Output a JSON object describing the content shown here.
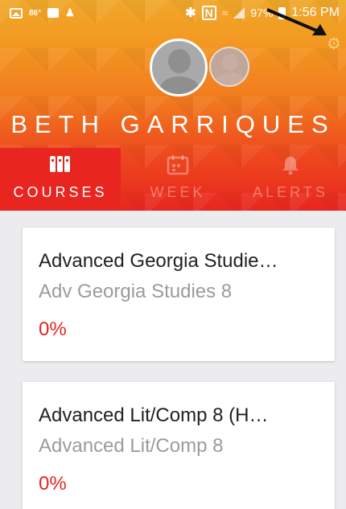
{
  "status_bar": {
    "temperature": "86°",
    "time": "1:56 PM",
    "battery_pct": "97%",
    "icons": [
      "image-icon",
      "app-icon",
      "person-icon",
      "bluetooth-icon",
      "nfc-icon",
      "wifi-icon",
      "signal-icon",
      "battery-icon"
    ]
  },
  "header": {
    "user_name": "BETH GARRIQUES",
    "settings_icon": "gear-icon",
    "accent_gradient": [
      "#f0a82a",
      "#e8261f"
    ]
  },
  "tabs": [
    {
      "label": "COURSES",
      "icon": "courses-icon",
      "active": true
    },
    {
      "label": "WEEK",
      "icon": "calendar-icon",
      "active": false
    },
    {
      "label": "ALERTS",
      "icon": "bell-icon",
      "active": false
    }
  ],
  "courses": [
    {
      "title": "Advanced Georgia Studie…",
      "subtitle": "Adv Georgia Studies 8",
      "grade": "0%"
    },
    {
      "title": "Advanced Lit/Comp 8 (H…",
      "subtitle": "Advanced Lit/Comp 8",
      "grade": "0%"
    }
  ],
  "colors": {
    "grade": "#e8241f",
    "subtitle": "#9b9b9b",
    "background": "#ececef"
  }
}
